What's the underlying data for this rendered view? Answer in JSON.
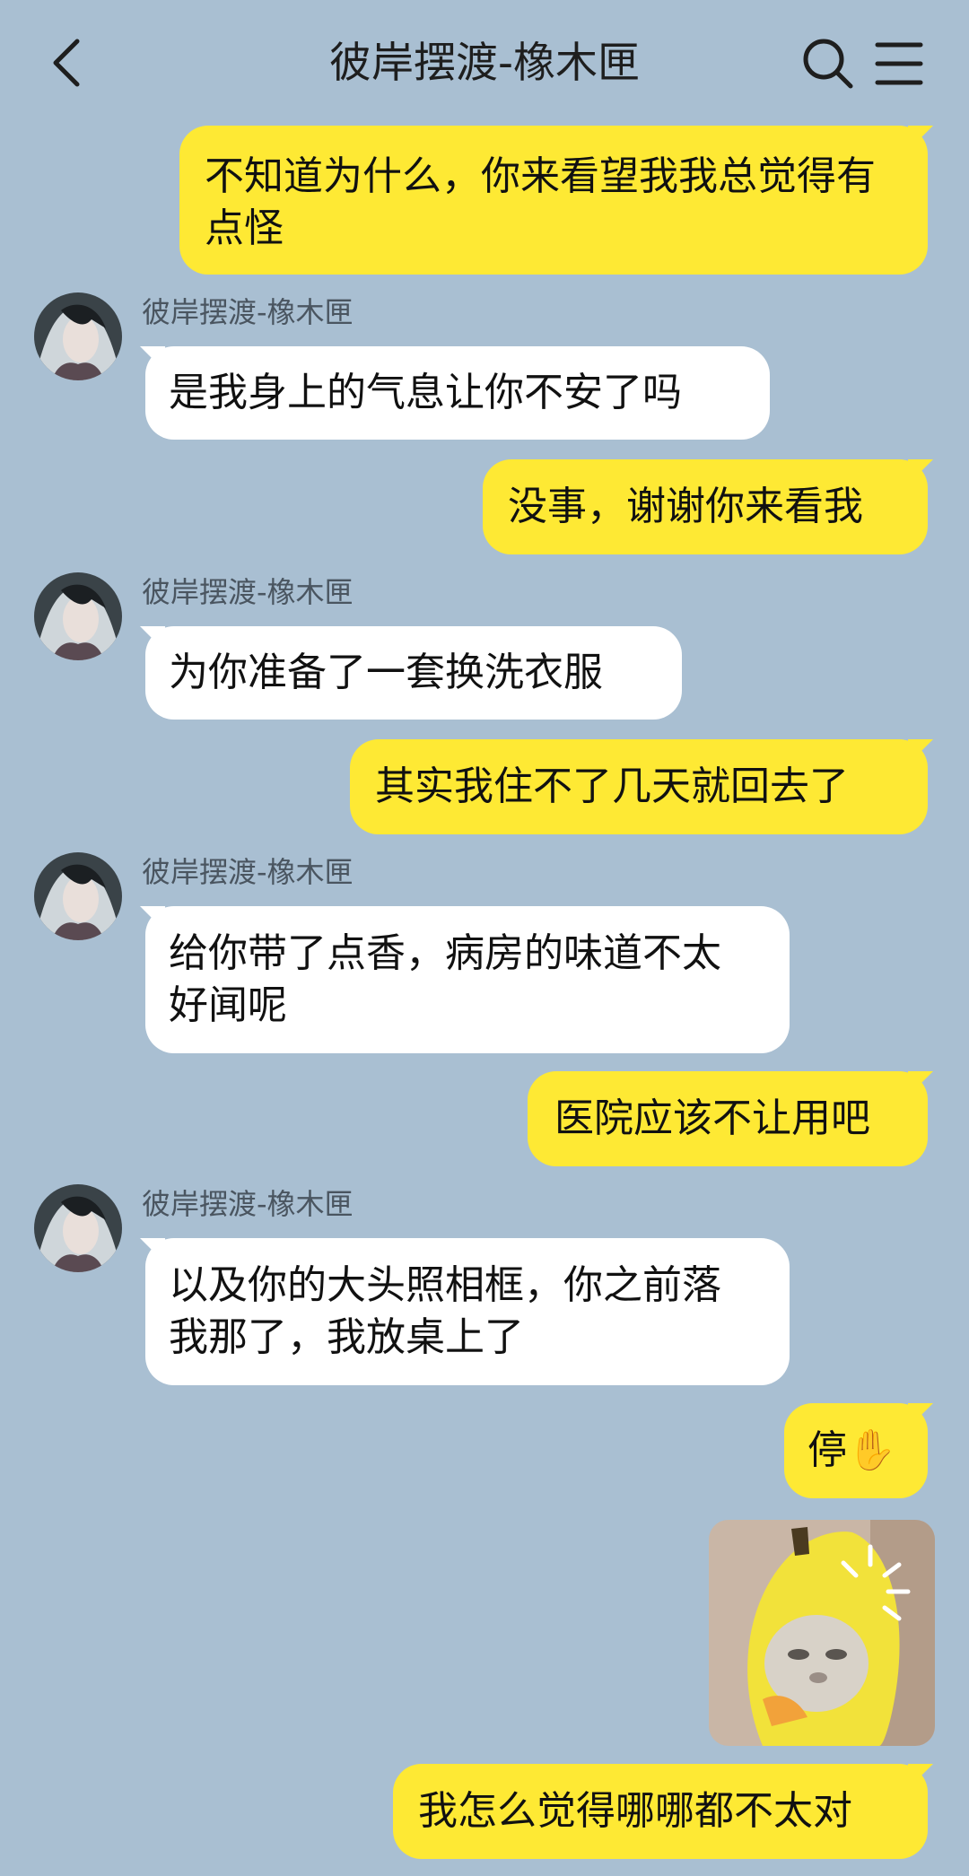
{
  "header": {
    "title": "彼岸摆渡-橡木匣",
    "icons": {
      "back": "chevron-left-icon",
      "search": "search-icon",
      "menu": "menu-icon"
    }
  },
  "colors": {
    "background": "#a9bfd2",
    "outgoing_bubble": "#fee934",
    "incoming_bubble": "#ffffff"
  },
  "messages": [
    {
      "side": "out",
      "text": "不知道为什么，你来看望我我总觉得有点怪"
    },
    {
      "side": "in",
      "sender": "彼岸摆渡-橡木匣",
      "text": "是我身上的气息让你不安了吗"
    },
    {
      "side": "out",
      "text": "没事，谢谢你来看我"
    },
    {
      "side": "in",
      "sender": "彼岸摆渡-橡木匣",
      "text": "为你准备了一套换洗衣服"
    },
    {
      "side": "out",
      "text": "其实我住不了几天就回去了"
    },
    {
      "side": "in",
      "sender": "彼岸摆渡-橡木匣",
      "text": "给你带了点香，病房的味道不太好闻呢"
    },
    {
      "side": "out",
      "text": "医院应该不让用吧"
    },
    {
      "side": "in",
      "sender": "彼岸摆渡-橡木匣",
      "text": "以及你的大头照相框，你之前落我那了，我放桌上了"
    },
    {
      "side": "out",
      "text": "停✋"
    },
    {
      "side": "out",
      "type": "sticker",
      "icon": "banana-cat-sticker"
    },
    {
      "side": "out",
      "text": "我怎么觉得哪哪都不太对"
    }
  ]
}
